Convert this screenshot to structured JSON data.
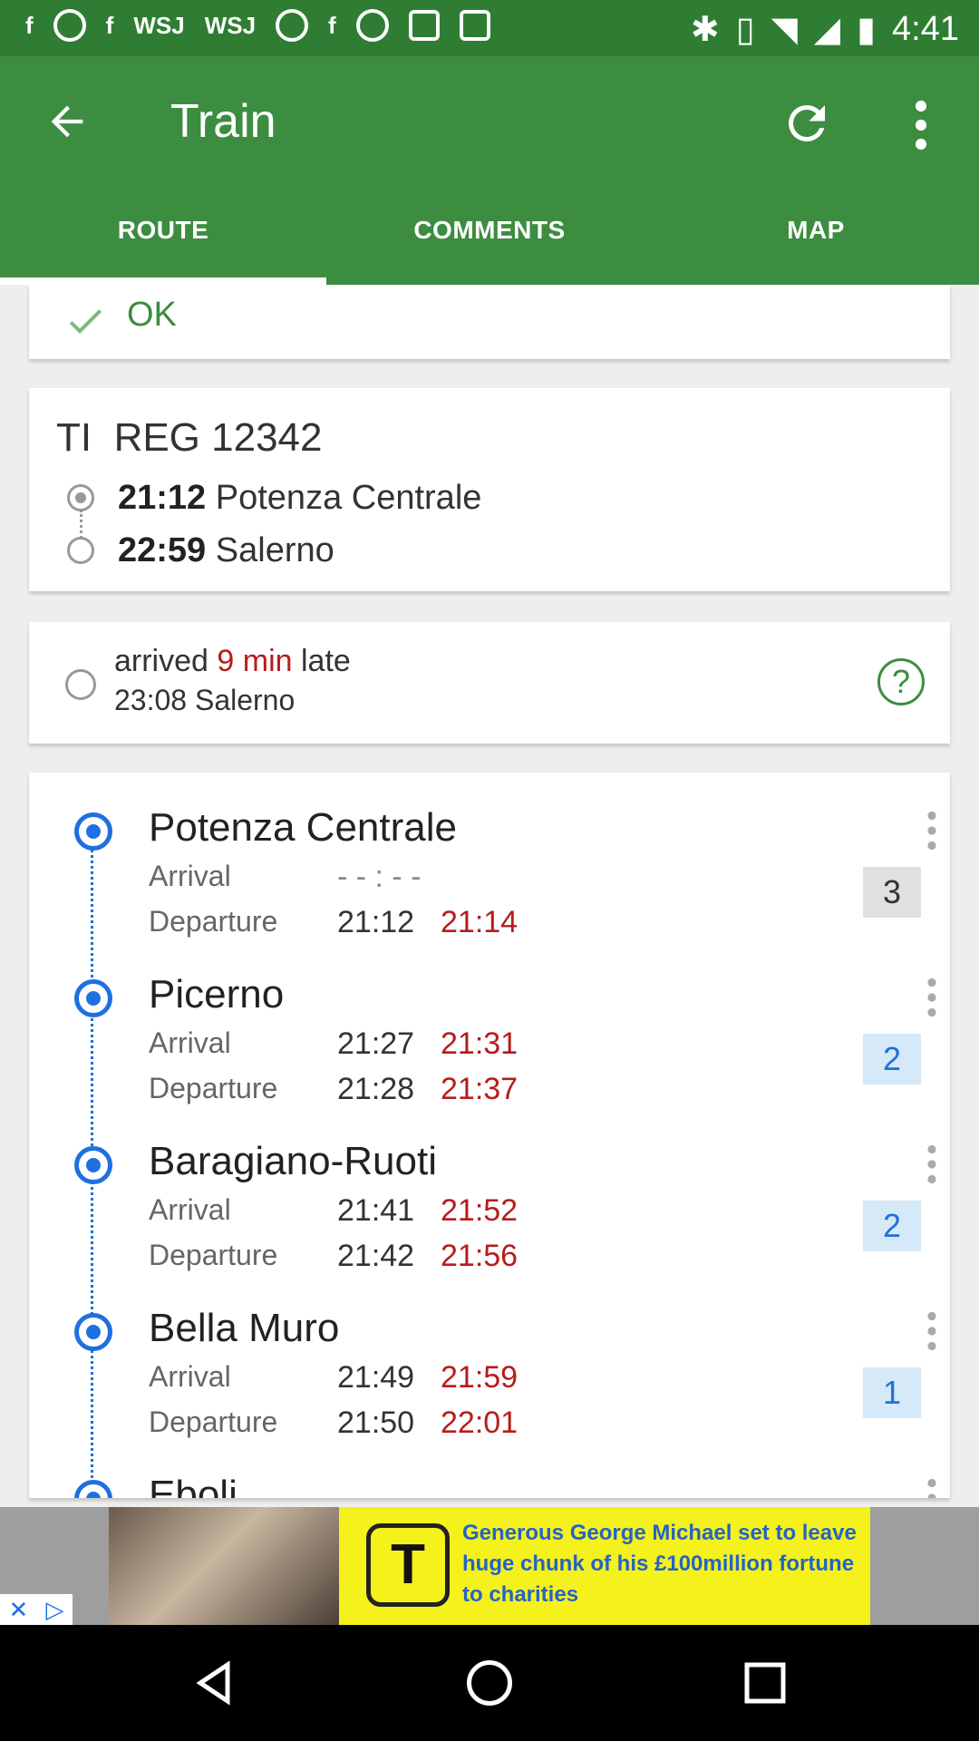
{
  "status_bar": {
    "time": "4:41",
    "left_icons": [
      "facebook-icon",
      "smiley-icon",
      "facebook-icon",
      "wsj-icon",
      "wsj-icon",
      "smiley-icon",
      "facebook-icon",
      "pause-icon",
      "lock-icon",
      "game-icon"
    ],
    "left_texts": {
      "wsj1": "WSJ",
      "wsj2": "WSJ"
    },
    "right_icons": [
      "bluetooth-icon",
      "vibrate-icon",
      "wifi-icon",
      "signal-icon",
      "battery-icon"
    ]
  },
  "app_bar": {
    "title": "Train",
    "tabs": [
      {
        "label": "ROUTE",
        "active": true
      },
      {
        "label": "COMMENTS",
        "active": false
      },
      {
        "label": "MAP",
        "active": false
      }
    ],
    "accent": "#3c8d40"
  },
  "ok_card": {
    "text": "OK"
  },
  "train": {
    "type": "TI",
    "name": "REG 12342",
    "from_time": "21:12",
    "from_station": "Potenza Centrale",
    "to_time": "22:59",
    "to_station": "Salerno"
  },
  "status": {
    "prefix": "arrived",
    "delay": "9 min",
    "suffix": "late",
    "detail": "23:08 Salerno",
    "help": "?"
  },
  "labels": {
    "arrival": "Arrival",
    "departure": "Departure"
  },
  "stops": [
    {
      "name": "Potenza Centrale",
      "arr_sched": "- - : - -",
      "arr_real": "",
      "dep_sched": "21:12",
      "dep_real": "21:14",
      "platform": "3",
      "platform_style": "gray"
    },
    {
      "name": "Picerno",
      "arr_sched": "21:27",
      "arr_real": "21:31",
      "dep_sched": "21:28",
      "dep_real": "21:37",
      "platform": "2",
      "platform_style": "blue"
    },
    {
      "name": "Baragiano-Ruoti",
      "arr_sched": "21:41",
      "arr_real": "21:52",
      "dep_sched": "21:42",
      "dep_real": "21:56",
      "platform": "2",
      "platform_style": "blue"
    },
    {
      "name": "Bella Muro",
      "arr_sched": "21:49",
      "arr_real": "21:59",
      "dep_sched": "21:50",
      "dep_real": "22:01",
      "platform": "1",
      "platform_style": "blue"
    },
    {
      "name": "Eboli",
      "arr_sched": "",
      "arr_real": "",
      "dep_sched": "",
      "dep_real": "",
      "platform": "",
      "platform_style": "blue"
    }
  ],
  "ad": {
    "logo": "T",
    "text": "Generous George Michael set to leave huge chunk of his £100million fortune to charities"
  }
}
